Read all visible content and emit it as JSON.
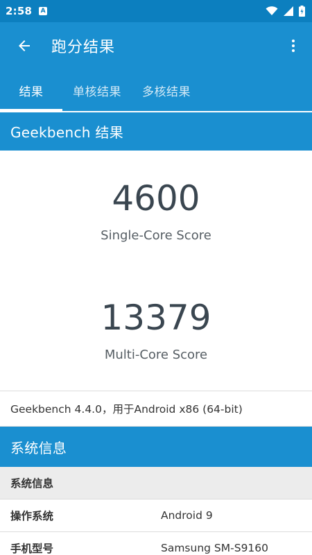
{
  "status_bar": {
    "time": "2:58",
    "a_badge": "A",
    "icons": [
      "wifi-icon",
      "signal-icon",
      "battery-icon"
    ]
  },
  "toolbar": {
    "title": "跑分结果",
    "back_icon": "arrow-back-icon",
    "overflow_icon": "more-vert-icon"
  },
  "tabs": [
    {
      "label": "结果",
      "active": true
    },
    {
      "label": "单核结果",
      "active": false
    },
    {
      "label": "多核结果",
      "active": false
    }
  ],
  "results_header": "Geekbench 结果",
  "scores": {
    "single": {
      "value": "4600",
      "label": "Single-Core Score"
    },
    "multi": {
      "value": "13379",
      "label": "Multi-Core Score"
    }
  },
  "version_text": "Geekbench 4.4.0，用于Android x86 (64-bit)",
  "system_header": "系统信息",
  "system_info": {
    "subheader": "系统信息",
    "rows": [
      {
        "key": "操作系统",
        "value": "Android 9"
      },
      {
        "key": "手机型号",
        "value": "Samsung SM-S9160"
      }
    ]
  },
  "colors": {
    "primary": "#1a8fd0",
    "status_bar": "#0c7fbf",
    "score_text": "#3a4650",
    "subheader_bg": "#ececec"
  }
}
